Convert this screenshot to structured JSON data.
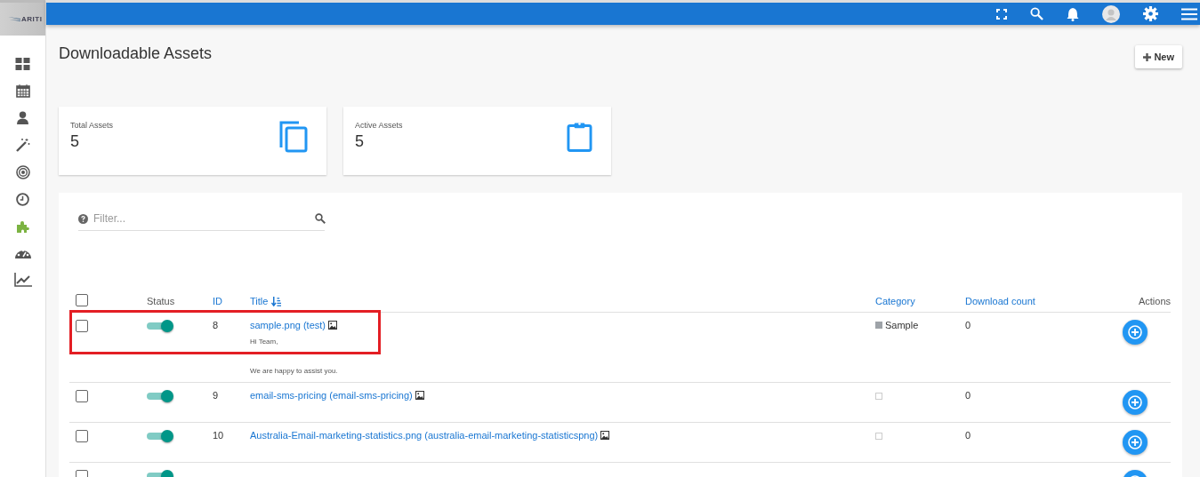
{
  "logo": {
    "text": "ARITI"
  },
  "page": {
    "title": "Downloadable Assets",
    "new_button": "New"
  },
  "stats": [
    {
      "label": "Total Assets",
      "value": "5"
    },
    {
      "label": "Active Assets",
      "value": "5"
    }
  ],
  "filter": {
    "placeholder": "Filter..."
  },
  "table": {
    "columns": [
      {
        "label": "Status",
        "kind": "plain"
      },
      {
        "label": "ID",
        "kind": "link"
      },
      {
        "label": "Title",
        "kind": "sorted"
      },
      {
        "label": "Category",
        "kind": "link"
      },
      {
        "label": "Download count",
        "kind": "link"
      },
      {
        "label": "Actions",
        "kind": "plain"
      }
    ],
    "select_all": false,
    "rows": [
      {
        "checked": false,
        "on": true,
        "id": "8",
        "title": "sample.png (test)",
        "description": [
          "Hi Team,",
          "We are happy to assist you."
        ],
        "category": {
          "name": "Sample",
          "color": "#9ea3a8"
        },
        "downloads": "0",
        "highlighted": true
      },
      {
        "checked": false,
        "on": true,
        "id": "9",
        "title": "email-sms-pricing (email-sms-pricing)",
        "downloads": "0",
        "highlighted": false
      },
      {
        "checked": false,
        "on": true,
        "id": "10",
        "title": "Australia-Email-marketing-statistics.png (australia-email-marketing-statisticspng)",
        "downloads": "0",
        "highlighted": false
      },
      {
        "checked": false,
        "on": true,
        "highlighted": false
      }
    ]
  }
}
